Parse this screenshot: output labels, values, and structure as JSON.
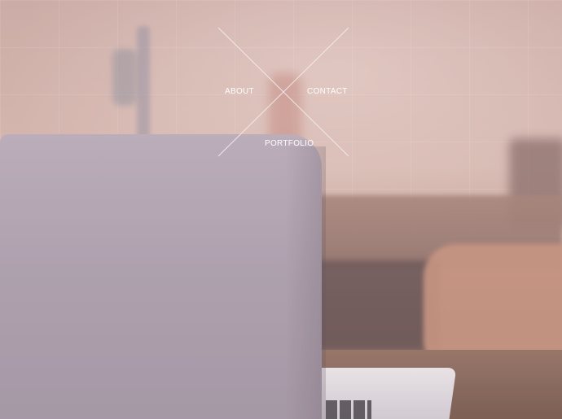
{
  "nav": {
    "items": [
      {
        "label": "ABOUT"
      },
      {
        "label": "CONTACT"
      },
      {
        "label": "PORTFOLIO"
      }
    ]
  },
  "colors": {
    "link": "#ffffff",
    "cross_lines": "#f4eeee"
  }
}
